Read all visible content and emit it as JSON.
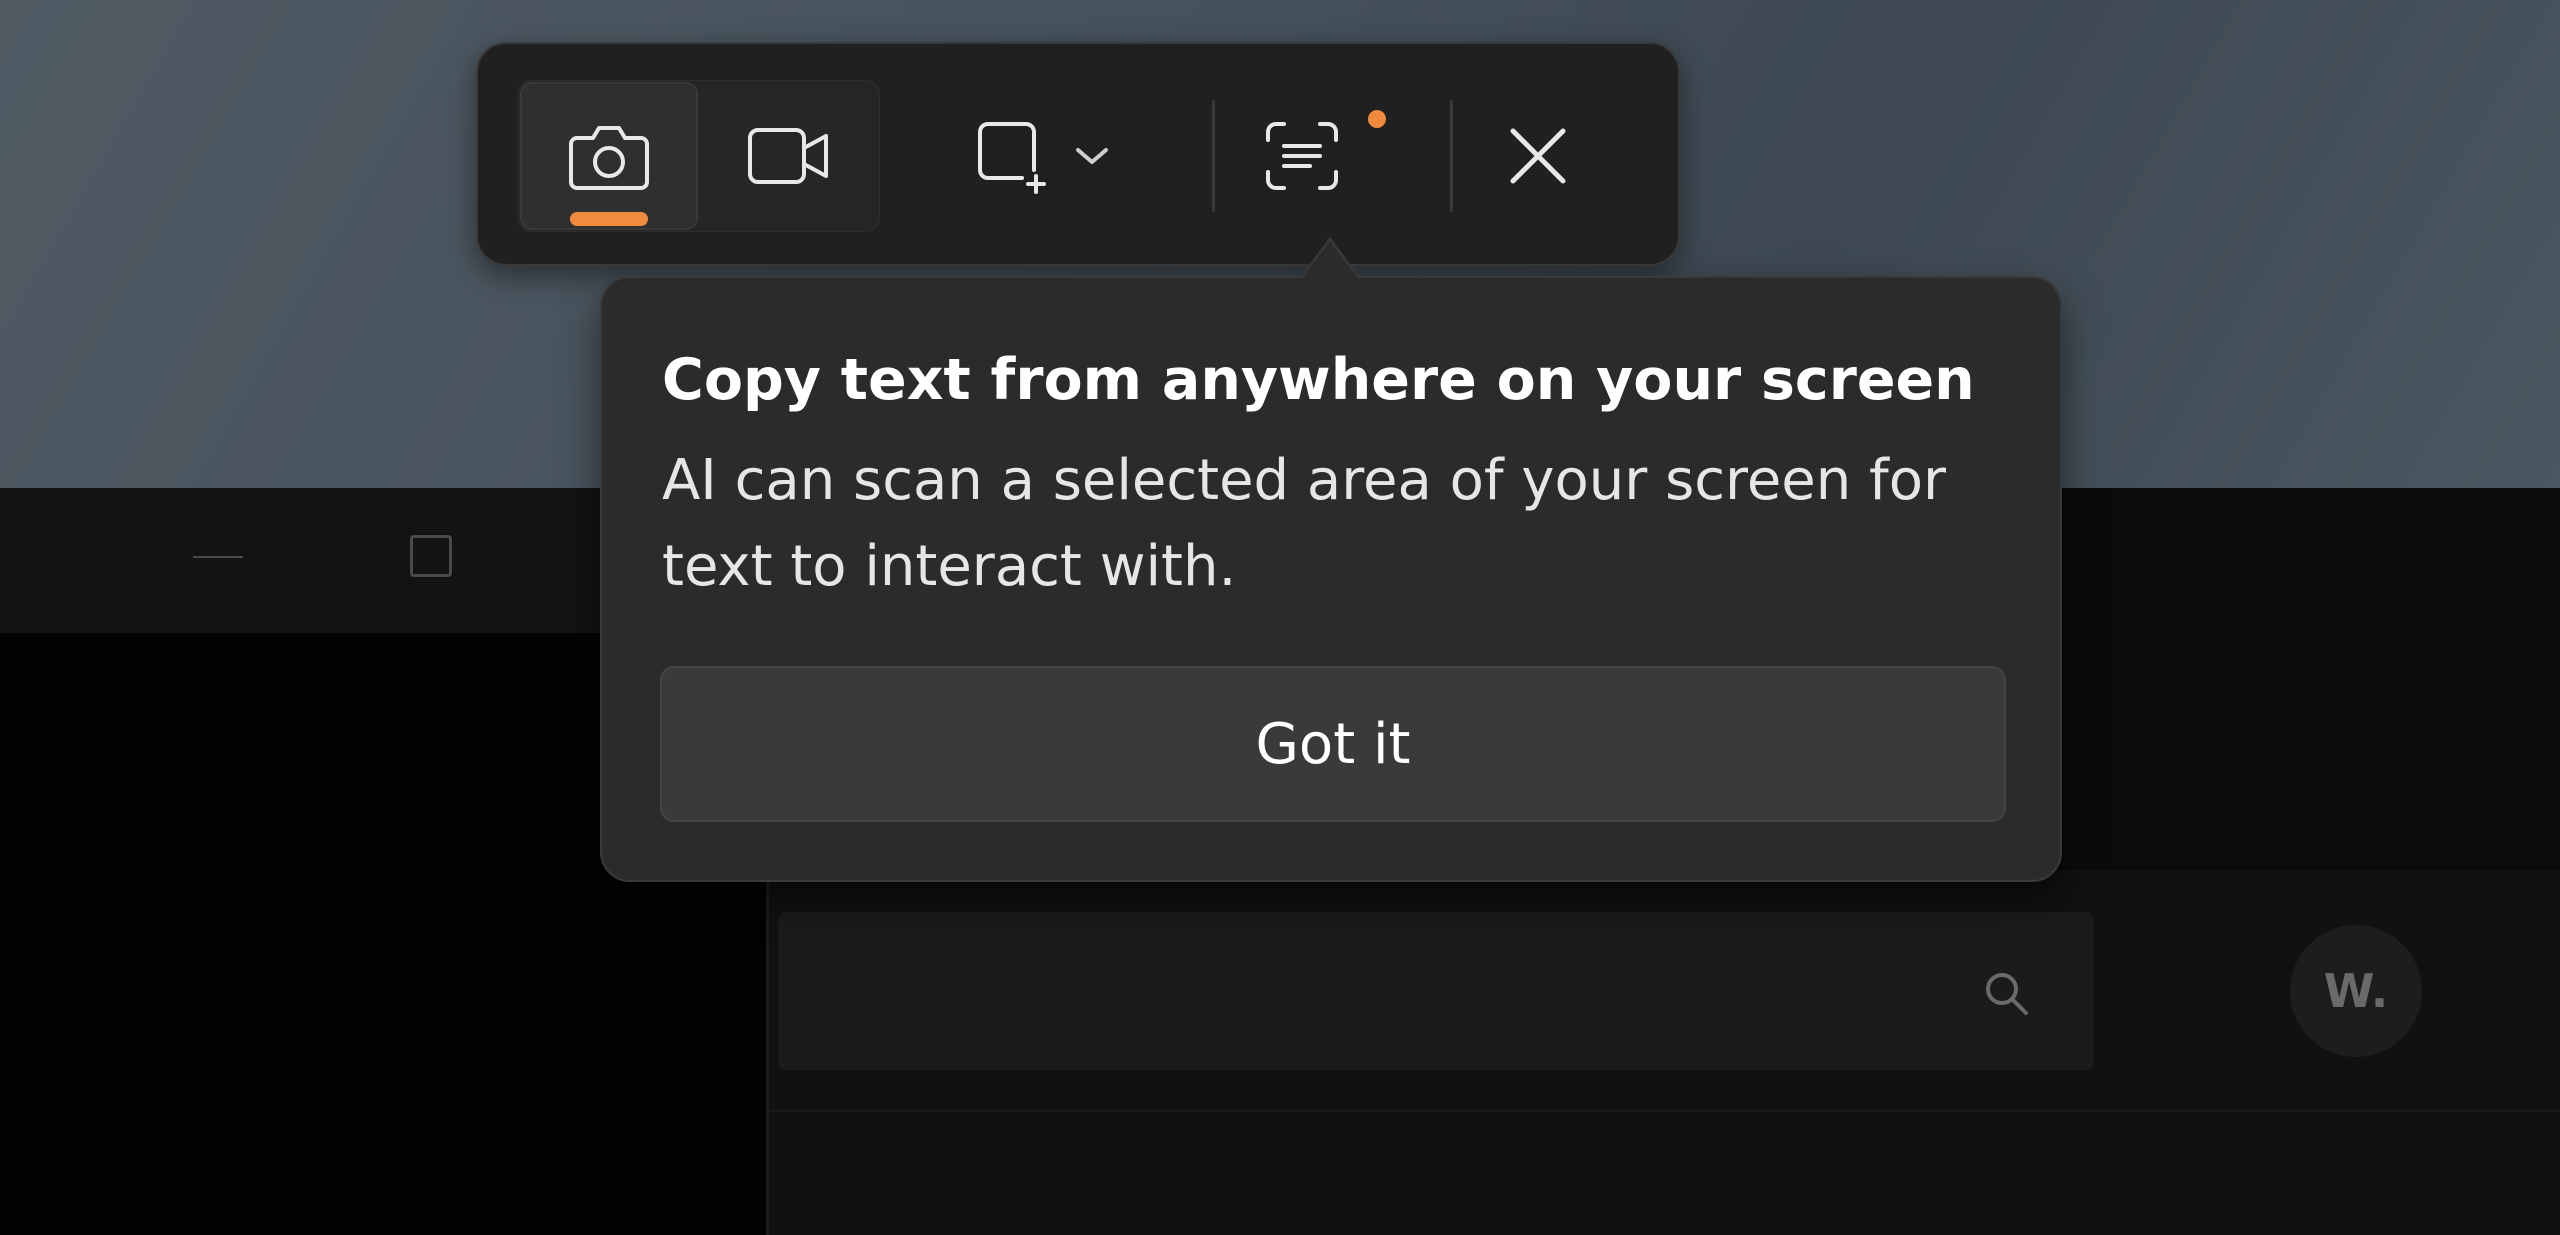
{
  "background_app": {
    "avatar_initials": "W."
  },
  "toolbar": {
    "modes": [
      {
        "name": "screenshot",
        "icon": "camera-icon",
        "active": true
      },
      {
        "name": "record",
        "icon": "video-camera-icon",
        "active": false
      }
    ],
    "shape_icon": "rectangle-select-icon",
    "text_action_icon": "text-extract-icon",
    "close_icon": "close-icon",
    "accent_color": "#f08a3c"
  },
  "teaching_tip": {
    "title": "Copy text from anywhere on your screen",
    "body": "AI can scan a selected area of your screen for text to interact with.",
    "button_label": "Got it"
  }
}
